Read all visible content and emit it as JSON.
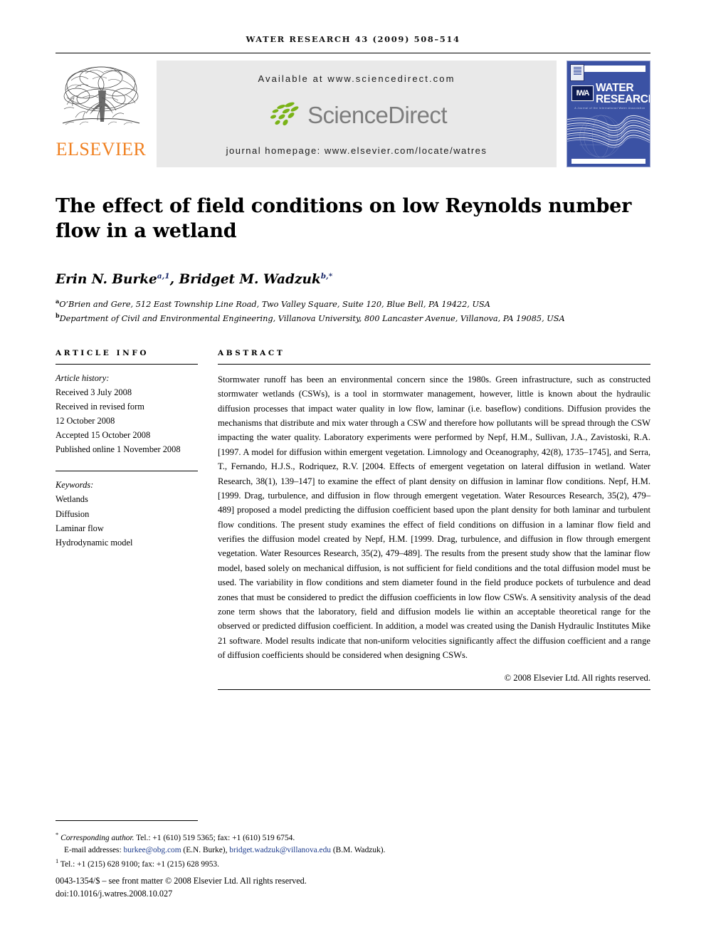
{
  "running_head": "WATER RESEARCH 43 (2009) 508–514",
  "masthead": {
    "publisher_name": "ELSEVIER",
    "publisher_logo_name": "elsevier-tree-logo",
    "available_at": "Available at www.sciencedirect.com",
    "sciencedirect_word": "ScienceDirect",
    "journal_homepage": "journal homepage: www.elsevier.com/locate/watres",
    "cover": {
      "title_line1": "WATER",
      "title_line2": "RESEARCH",
      "subtitle": "A Journal of the International Water Association",
      "iwa_mark": "IWA",
      "background_color": "#3b52a4"
    }
  },
  "article": {
    "title": "The effect of field conditions on low Reynolds number flow in a wetland",
    "authors_html": "Erin N. Burke, Bridget M. Wadzuk",
    "author1_name": "Erin N. Burke",
    "author1_marks": "a,1",
    "author2_name": "Bridget M. Wadzuk",
    "author2_marks": "b,*",
    "affiliations": [
      {
        "mark": "a",
        "text": "O’Brien and Gere, 512 East Township Line Road, Two Valley Square, Suite 120, Blue Bell, PA 19422, USA"
      },
      {
        "mark": "b",
        "text": "Department of Civil and Environmental Engineering, Villanova University, 800 Lancaster Avenue, Villanova, PA 19085, USA"
      }
    ]
  },
  "article_info": {
    "heading": "ARTICLE INFO",
    "history_label": "Article history:",
    "history": [
      "Received 3 July 2008",
      "Received in revised form",
      "12 October 2008",
      "Accepted 15 October 2008",
      "Published online 1 November 2008"
    ],
    "keywords_label": "Keywords:",
    "keywords": [
      "Wetlands",
      "Diffusion",
      "Laminar flow",
      "Hydrodynamic model"
    ]
  },
  "abstract": {
    "heading": "ABSTRACT",
    "text": "Stormwater runoff has been an environmental concern since the 1980s. Green infrastructure, such as constructed stormwater wetlands (CSWs), is a tool in stormwater management, however, little is known about the hydraulic diffusion processes that impact water quality in low flow, laminar (i.e. baseflow) conditions. Diffusion provides the mechanisms that distribute and mix water through a CSW and therefore how pollutants will be spread through the CSW impacting the water quality. Laboratory experiments were performed by Nepf, H.M., Sullivan, J.A., Zavistoski, R.A. [1997. A model for diffusion within emergent vegetation. Limnology and Oceanography, 42(8), 1735–1745], and Serra, T., Fernando, H.J.S., Rodriquez, R.V. [2004. Effects of emergent vegetation on lateral diffusion in wetland. Water Research, 38(1), 139–147] to examine the effect of plant density on diffusion in laminar flow conditions. Nepf, H.M. [1999. Drag, turbulence, and diffusion in flow through emergent vegetation. Water Resources Research, 35(2), 479–489] proposed a model predicting the diffusion coefficient based upon the plant density for both laminar and turbulent flow conditions. The present study examines the effect of field conditions on diffusion in a laminar flow field and verifies the diffusion model created by Nepf, H.M. [1999. Drag, turbulence, and diffusion in flow through emergent vegetation. Water Resources Research, 35(2), 479–489]. The results from the present study show that the laminar flow model, based solely on mechanical diffusion, is not sufficient for field conditions and the total diffusion model must be used. The variability in flow conditions and stem diameter found in the field produce pockets of turbulence and dead zones that must be considered to predict the diffusion coefficients in low flow CSWs. A sensitivity analysis of the dead zone term shows that the laboratory, field and diffusion models lie within an acceptable theoretical range for the observed or predicted diffusion coefficient. In addition, a model was created using the Danish Hydraulic Institutes Mike 21 software. Model results indicate that non-uniform velocities significantly affect the diffusion coefficient and a range of diffusion coefficients should be considered when designing CSWs.",
    "copyright": "© 2008 Elsevier Ltd. All rights reserved."
  },
  "footnotes": {
    "corresponding_mark": "*",
    "corresponding_label": "Corresponding author.",
    "corresponding_contact": " Tel.: +1 (610) 519 5365; fax: +1 (610) 519 6754.",
    "email_label": "E-mail addresses:",
    "email1": "burkee@obg.com",
    "email1_owner": "(E.N. Burke),",
    "email2": "bridget.wadzuk@villanova.edu",
    "email2_owner": "(B.M. Wadzuk).",
    "note1_mark": "1",
    "note1_text": "Tel.: +1 (215) 628 9100; fax: +1 (215) 628 9953.",
    "issn_line": "0043-1354/$ – see front matter © 2008 Elsevier Ltd. All rights reserved.",
    "doi_line": "doi:10.1016/j.watres.2008.10.027"
  }
}
